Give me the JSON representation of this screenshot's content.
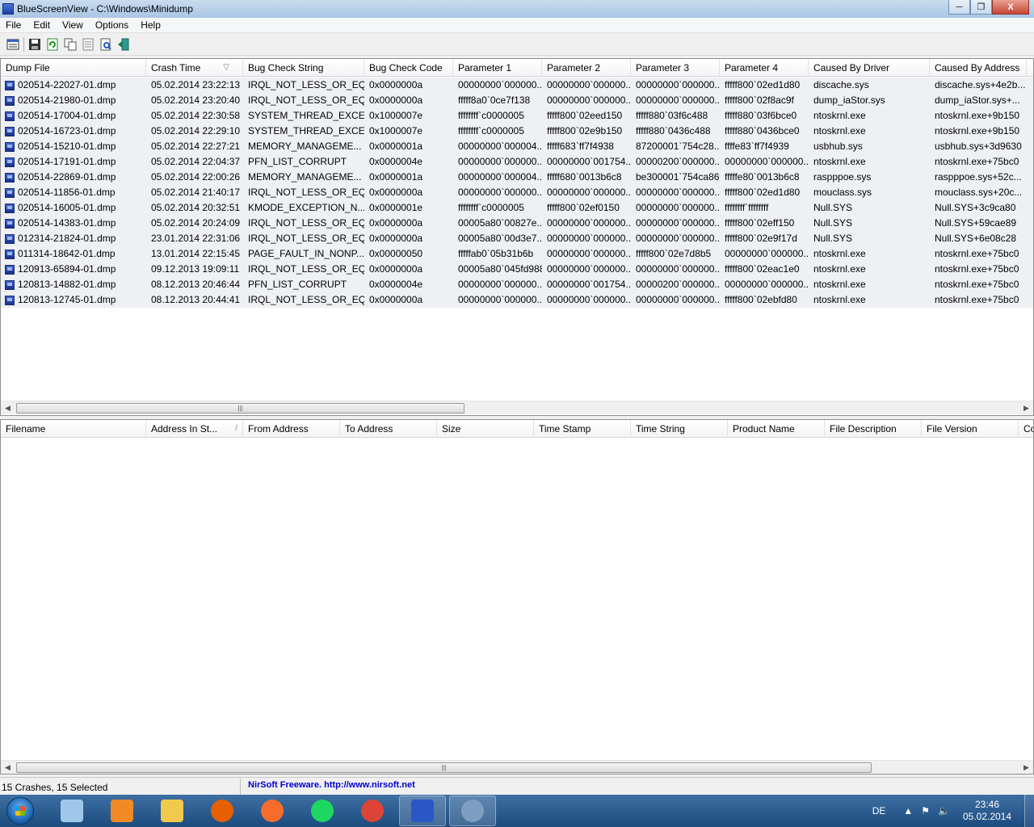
{
  "window": {
    "title": "BlueScreenView  -  C:\\Windows\\Minidump",
    "minimize_icon": "minimize-icon",
    "maximize_icon": "restore-icon",
    "close_label": "X"
  },
  "menu": [
    "File",
    "Edit",
    "View",
    "Options",
    "Help"
  ],
  "toolbar": [
    "properties-icon",
    "save-icon",
    "refresh-icon",
    "copy-icon",
    "html-report-icon",
    "find-icon",
    "exit-icon"
  ],
  "top_table": {
    "columns": [
      {
        "label": "Dump File",
        "sort": ""
      },
      {
        "label": "Crash Time",
        "sort": "▽"
      },
      {
        "label": "Bug Check String",
        "sort": ""
      },
      {
        "label": "Bug Check Code",
        "sort": ""
      },
      {
        "label": "Parameter 1",
        "sort": ""
      },
      {
        "label": "Parameter 2",
        "sort": ""
      },
      {
        "label": "Parameter 3",
        "sort": ""
      },
      {
        "label": "Parameter 4",
        "sort": ""
      },
      {
        "label": "Caused By Driver",
        "sort": ""
      },
      {
        "label": "Caused By Address",
        "sort": ""
      }
    ],
    "rows": [
      [
        "020514-22027-01.dmp",
        "05.02.2014 23:22:13",
        "IRQL_NOT_LESS_OR_EQ...",
        "0x0000000a",
        "00000000`000000...",
        "00000000`000000...",
        "00000000`000000...",
        "fffff800`02ed1d80",
        "discache.sys",
        "discache.sys+4e2b..."
      ],
      [
        "020514-21980-01.dmp",
        "05.02.2014 23:20:40",
        "IRQL_NOT_LESS_OR_EQ...",
        "0x0000000a",
        "fffff8a0`0ce7f138",
        "00000000`000000...",
        "00000000`000000...",
        "fffff800`02f8ac9f",
        "dump_iaStor.sys",
        "dump_iaStor.sys+..."
      ],
      [
        "020514-17004-01.dmp",
        "05.02.2014 22:30:58",
        "SYSTEM_THREAD_EXCE...",
        "0x1000007e",
        "ffffffff`c0000005",
        "fffff800`02eed150",
        "fffff880`03f6c488",
        "fffff880`03f6bce0",
        "ntoskrnl.exe",
        "ntoskrnl.exe+9b150"
      ],
      [
        "020514-16723-01.dmp",
        "05.02.2014 22:29:10",
        "SYSTEM_THREAD_EXCE...",
        "0x1000007e",
        "ffffffff`c0000005",
        "fffff800`02e9b150",
        "fffff880`0436c488",
        "fffff880`0436bce0",
        "ntoskrnl.exe",
        "ntoskrnl.exe+9b150"
      ],
      [
        "020514-15210-01.dmp",
        "05.02.2014 22:27:21",
        "MEMORY_MANAGEME...",
        "0x0000001a",
        "00000000`000004...",
        "fffff683`ff7f4938",
        "87200001`754c28...",
        "ffffe83`ff7f4939",
        "usbhub.sys",
        "usbhub.sys+3d9630"
      ],
      [
        "020514-17191-01.dmp",
        "05.02.2014 22:04:37",
        "PFN_LIST_CORRUPT",
        "0x0000004e",
        "00000000`000000...",
        "00000000`001754...",
        "00000200`000000...",
        "00000000`000000...",
        "ntoskrnl.exe",
        "ntoskrnl.exe+75bc0"
      ],
      [
        "020514-22869-01.dmp",
        "05.02.2014 22:00:26",
        "MEMORY_MANAGEME...",
        "0x0000001a",
        "00000000`000004...",
        "fffff680`0013b6c8",
        "be300001`754ca86f",
        "fffffe80`0013b6c8",
        "raspppoe.sys",
        "raspppoe.sys+52c..."
      ],
      [
        "020514-11856-01.dmp",
        "05.02.2014 21:40:17",
        "IRQL_NOT_LESS_OR_EQ...",
        "0x0000000a",
        "00000000`000000...",
        "00000000`000000...",
        "00000000`000000...",
        "fffff800`02ed1d80",
        "mouclass.sys",
        "mouclass.sys+20c..."
      ],
      [
        "020514-16005-01.dmp",
        "05.02.2014 20:32:51",
        "KMODE_EXCEPTION_N...",
        "0x0000001e",
        "ffffffff`c0000005",
        "fffff800`02ef0150",
        "00000000`000000...",
        "ffffffff`ffffffff",
        "Null.SYS",
        "Null.SYS+3c9ca80"
      ],
      [
        "020514-14383-01.dmp",
        "05.02.2014 20:24:09",
        "IRQL_NOT_LESS_OR_EQ...",
        "0x0000000a",
        "00005a80`00827e...",
        "00000000`000000...",
        "00000000`000000...",
        "fffff800`02eff150",
        "Null.SYS",
        "Null.SYS+59cae89"
      ],
      [
        "012314-21824-01.dmp",
        "23.01.2014 22:31:06",
        "IRQL_NOT_LESS_OR_EQ...",
        "0x0000000a",
        "00005a80`00d3e7...",
        "00000000`000000...",
        "00000000`000000...",
        "fffff800`02e9f17d",
        "Null.SYS",
        "Null.SYS+6e08c28"
      ],
      [
        "011314-18642-01.dmp",
        "13.01.2014 22:15:45",
        "PAGE_FAULT_IN_NONP...",
        "0x00000050",
        "fffffab0`05b31b6b",
        "00000000`000000...",
        "fffff800`02e7d8b5",
        "00000000`000000...",
        "ntoskrnl.exe",
        "ntoskrnl.exe+75bc0"
      ],
      [
        "120913-65894-01.dmp",
        "09.12.2013 19:09:11",
        "IRQL_NOT_LESS_OR_EQ...",
        "0x0000000a",
        "00005a80`045fd988",
        "00000000`000000...",
        "00000000`000000...",
        "fffff800`02eac1e0",
        "ntoskrnl.exe",
        "ntoskrnl.exe+75bc0"
      ],
      [
        "120813-14882-01.dmp",
        "08.12.2013 20:46:44",
        "PFN_LIST_CORRUPT",
        "0x0000004e",
        "00000000`000000...",
        "00000000`001754...",
        "00000200`000000...",
        "00000000`000000...",
        "ntoskrnl.exe",
        "ntoskrnl.exe+75bc0"
      ],
      [
        "120813-12745-01.dmp",
        "08.12.2013 20:44:41",
        "IRQL_NOT_LESS_OR_EQ...",
        "0x0000000a",
        "00000000`000000...",
        "00000000`000000...",
        "00000000`000000...",
        "fffff800`02ebfd80",
        "ntoskrnl.exe",
        "ntoskrnl.exe+75bc0"
      ]
    ]
  },
  "bottom_table": {
    "columns": [
      {
        "label": "Filename",
        "sort": ""
      },
      {
        "label": "Address In St...",
        "sort": "/"
      },
      {
        "label": "From Address",
        "sort": ""
      },
      {
        "label": "To Address",
        "sort": ""
      },
      {
        "label": "Size",
        "sort": ""
      },
      {
        "label": "Time Stamp",
        "sort": ""
      },
      {
        "label": "Time String",
        "sort": ""
      },
      {
        "label": "Product Name",
        "sort": ""
      },
      {
        "label": "File Description",
        "sort": ""
      },
      {
        "label": "File Version",
        "sort": ""
      },
      {
        "label": "Co",
        "sort": ""
      }
    ],
    "rows": []
  },
  "scrollbars": {
    "left_arrow": "◀",
    "right_arrow": "▶",
    "grip": "|||"
  },
  "status": {
    "count": "15 Crashes, 15 Selected",
    "nirsoft": "NirSoft Freeware.  http://www.nirsoft.net"
  },
  "taskbar": {
    "items": [
      {
        "name": "snipping-tool-icon",
        "color": "#9ec7ea"
      },
      {
        "name": "media-player-icon",
        "color": "#f08a24"
      },
      {
        "name": "explorer-icon",
        "color": "#f2c94c"
      },
      {
        "name": "firefox-icon",
        "color": "#e66000"
      },
      {
        "name": "origin-icon",
        "color": "#f56c2d"
      },
      {
        "name": "spotify-icon",
        "color": "#1ed760"
      },
      {
        "name": "chrome-icon",
        "color": "#db4437"
      },
      {
        "name": "bluescreenview-icon",
        "color": "#2a56c6",
        "active": true
      },
      {
        "name": "teamspeak-icon",
        "color": "#7f9fc1",
        "active": true
      }
    ],
    "lang": "DE",
    "time": "23:46",
    "date": "05.02.2014"
  },
  "colors": {
    "row_bg": "#eef0f3",
    "link": "#0000d0"
  }
}
